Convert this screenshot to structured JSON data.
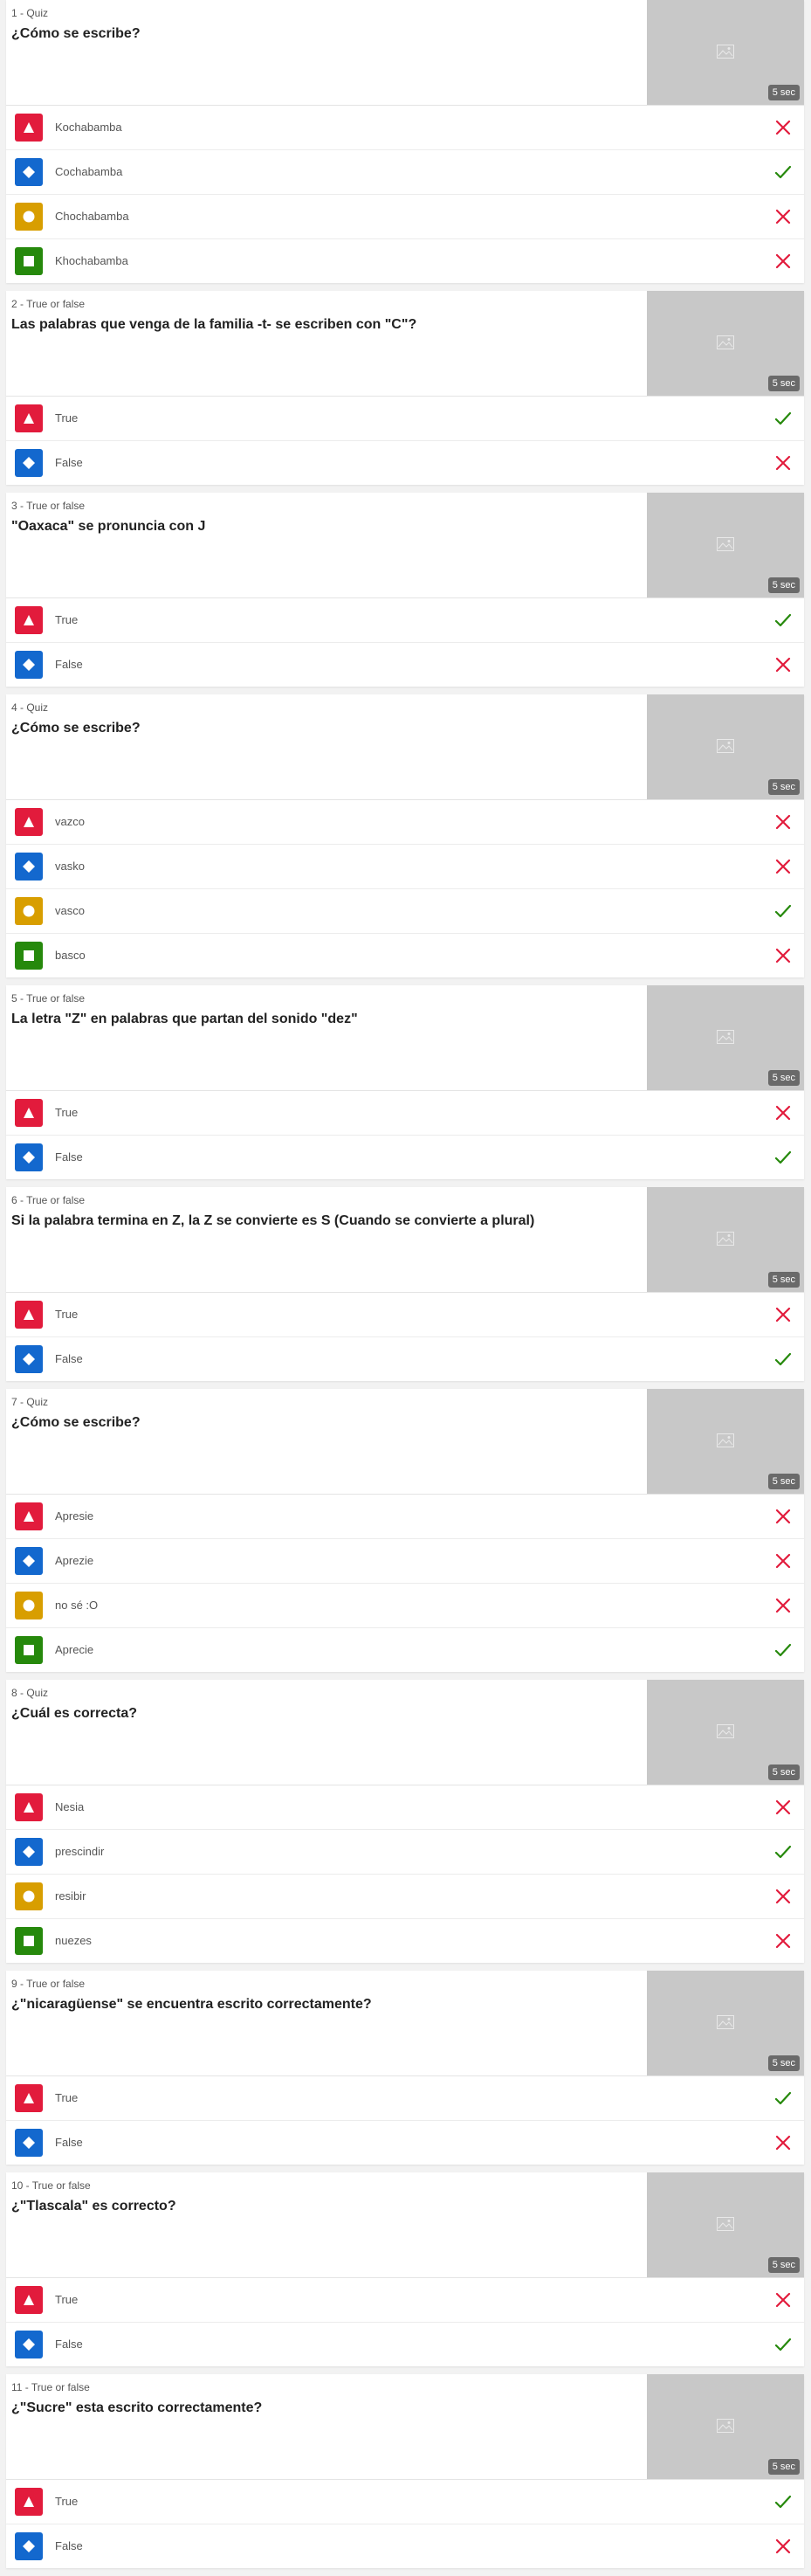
{
  "colors": {
    "triangle": "#e21b3c",
    "diamond": "#1368ce",
    "circle": "#d89e00",
    "square": "#26890c",
    "correct": "#26890c",
    "incorrect": "#e21b3c"
  },
  "questions": [
    {
      "type_label": "1 - Quiz",
      "text": "¿Cómo se escribe?",
      "time": "5 sec",
      "image_icon": "image-placeholder-icon",
      "answers": [
        {
          "shape": "triangle",
          "text": "Kochabamba",
          "correct": false
        },
        {
          "shape": "diamond",
          "text": "Cochabamba",
          "correct": true
        },
        {
          "shape": "circle",
          "text": "Chochabamba",
          "correct": false
        },
        {
          "shape": "square",
          "text": "Khochabamba",
          "correct": false
        }
      ]
    },
    {
      "type_label": "2 - True or false",
      "text": "Las palabras que venga de la familia -t- se escriben con \"C\"?",
      "time": "5 sec",
      "image_icon": "image-placeholder-icon",
      "answers": [
        {
          "shape": "triangle",
          "text": "True",
          "correct": true
        },
        {
          "shape": "diamond",
          "text": "False",
          "correct": false
        }
      ]
    },
    {
      "type_label": "3 - True or false",
      "text": "\"Oaxaca\" se pronuncia con J",
      "time": "5 sec",
      "image_icon": "image-placeholder-icon",
      "answers": [
        {
          "shape": "triangle",
          "text": "True",
          "correct": true
        },
        {
          "shape": "diamond",
          "text": "False",
          "correct": false
        }
      ]
    },
    {
      "type_label": "4 - Quiz",
      "text": "¿Cómo se escribe?",
      "time": "5 sec",
      "image_icon": "image-placeholder-icon",
      "answers": [
        {
          "shape": "triangle",
          "text": "vazco",
          "correct": false
        },
        {
          "shape": "diamond",
          "text": "vasko",
          "correct": false
        },
        {
          "shape": "circle",
          "text": "vasco",
          "correct": true
        },
        {
          "shape": "square",
          "text": "basco",
          "correct": false
        }
      ]
    },
    {
      "type_label": "5 - True or false",
      "text": "La letra \"Z\" en palabras que partan del sonido \"dez\"",
      "time": "5 sec",
      "image_icon": "image-placeholder-icon",
      "answers": [
        {
          "shape": "triangle",
          "text": "True",
          "correct": false
        },
        {
          "shape": "diamond",
          "text": "False",
          "correct": true
        }
      ]
    },
    {
      "type_label": "6 - True or false",
      "text": "Si la palabra termina en Z, la Z se convierte es S (Cuando se convierte a plural)",
      "time": "5 sec",
      "image_icon": "image-placeholder-icon",
      "answers": [
        {
          "shape": "triangle",
          "text": "True",
          "correct": false
        },
        {
          "shape": "diamond",
          "text": "False",
          "correct": true
        }
      ]
    },
    {
      "type_label": "7 - Quiz",
      "text": "¿Cómo se escribe?",
      "time": "5 sec",
      "image_icon": "image-placeholder-icon",
      "answers": [
        {
          "shape": "triangle",
          "text": "Apresie",
          "correct": false
        },
        {
          "shape": "diamond",
          "text": "Aprezie",
          "correct": false
        },
        {
          "shape": "circle",
          "text": "no sé :O",
          "correct": false
        },
        {
          "shape": "square",
          "text": "Aprecie",
          "correct": true
        }
      ]
    },
    {
      "type_label": "8 - Quiz",
      "text": "¿Cuál es correcta?",
      "time": "5 sec",
      "image_icon": "image-placeholder-icon",
      "answers": [
        {
          "shape": "triangle",
          "text": "Nesia",
          "correct": false
        },
        {
          "shape": "diamond",
          "text": "prescindir",
          "correct": true
        },
        {
          "shape": "circle",
          "text": "resibir",
          "correct": false
        },
        {
          "shape": "square",
          "text": "nuezes",
          "correct": false
        }
      ]
    },
    {
      "type_label": "9 - True or false",
      "text": "¿\"nicaragüense\" se encuentra escrito correctamente?",
      "time": "5 sec",
      "image_icon": "image-placeholder-icon",
      "answers": [
        {
          "shape": "triangle",
          "text": "True",
          "correct": true
        },
        {
          "shape": "diamond",
          "text": "False",
          "correct": false
        }
      ]
    },
    {
      "type_label": "10 - True or false",
      "text": "¿\"Tlascala\" es correcto?",
      "time": "5 sec",
      "image_icon": "image-placeholder-icon",
      "answers": [
        {
          "shape": "triangle",
          "text": "True",
          "correct": false
        },
        {
          "shape": "diamond",
          "text": "False",
          "correct": true
        }
      ]
    },
    {
      "type_label": "11 - True or false",
      "text": "¿\"Sucre\" esta escrito correctamente?",
      "time": "5 sec",
      "image_icon": "image-placeholder-icon",
      "answers": [
        {
          "shape": "triangle",
          "text": "True",
          "correct": true
        },
        {
          "shape": "diamond",
          "text": "False",
          "correct": false
        }
      ]
    }
  ]
}
